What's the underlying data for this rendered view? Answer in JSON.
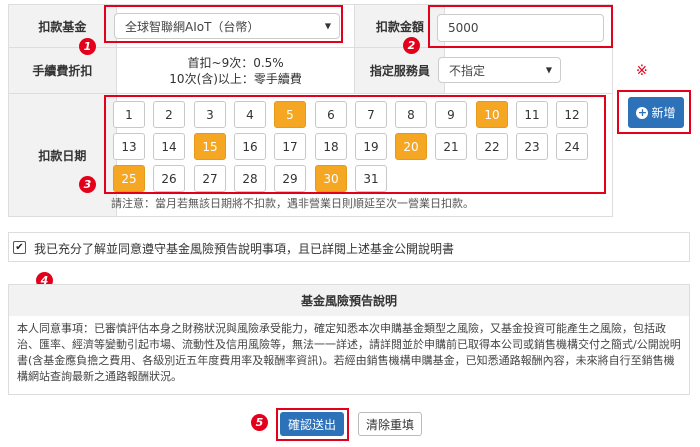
{
  "form": {
    "fund_label": "扣款基金",
    "fund_value": "全球智聯網AIoT（台幣）",
    "amount_label": "扣款金額",
    "amount_value": "5000",
    "fee_label": "手續費折扣",
    "fee_line1": "首扣~9次：0.5%",
    "fee_line2": "10次(含)以上：零手續費",
    "staff_label": "指定服務員",
    "staff_value": "不指定",
    "date_label": "扣款日期",
    "date_note": "請注意：當月若無該日期將不扣款，遇非營業日則順延至次一營業日扣款。",
    "add_button": "新增",
    "asterisk": "※"
  },
  "days": [
    {
      "label": "1",
      "selected": false
    },
    {
      "label": "2",
      "selected": false
    },
    {
      "label": "3",
      "selected": false
    },
    {
      "label": "4",
      "selected": false
    },
    {
      "label": "5",
      "selected": true
    },
    {
      "label": "6",
      "selected": false
    },
    {
      "label": "7",
      "selected": false
    },
    {
      "label": "8",
      "selected": false
    },
    {
      "label": "9",
      "selected": false
    },
    {
      "label": "10",
      "selected": true
    },
    {
      "label": "11",
      "selected": false
    },
    {
      "label": "12",
      "selected": false
    },
    {
      "label": "13",
      "selected": false
    },
    {
      "label": "14",
      "selected": false
    },
    {
      "label": "15",
      "selected": true
    },
    {
      "label": "16",
      "selected": false
    },
    {
      "label": "17",
      "selected": false
    },
    {
      "label": "18",
      "selected": false
    },
    {
      "label": "19",
      "selected": false
    },
    {
      "label": "20",
      "selected": true
    },
    {
      "label": "21",
      "selected": false
    },
    {
      "label": "22",
      "selected": false
    },
    {
      "label": "23",
      "selected": false
    },
    {
      "label": "24",
      "selected": false
    },
    {
      "label": "25",
      "selected": true
    },
    {
      "label": "26",
      "selected": false
    },
    {
      "label": "27",
      "selected": false
    },
    {
      "label": "28",
      "selected": false
    },
    {
      "label": "29",
      "selected": false
    },
    {
      "label": "30",
      "selected": true
    },
    {
      "label": "31",
      "selected": false
    }
  ],
  "agreement": {
    "checked": true,
    "check_mark": "✔",
    "text": "我已充分了解並同意遵守基金風險預告說明事項，且已詳閱上述基金公開說明書"
  },
  "risk": {
    "title": "基金風險預告說明",
    "body": "本人同意事項：已審慎評估本身之財務狀況與風險承受能力，確定知悉本次申購基金類型之風險，又基金投資可能產生之風險，包括政治、匯率、經濟等變動引起市場、流動性及信用風險等，無法一一詳述，請詳閱並於申購前已取得本公司或銷售機構交付之簡式/公開說明書(含基金應負擔之費用、各級別近五年度費用率及報酬率資訊)。若經由銷售機構申購基金，已知悉通路報酬內容，未來將自行至銷售機構網站查詢最新之通路報酬狀況。"
  },
  "actions": {
    "submit": "確認送出",
    "reset": "清除重填"
  },
  "markers": [
    "1",
    "2",
    "3",
    "4",
    "5"
  ],
  "colors": {
    "accent_blue": "#2d72b9",
    "selected_day": "#f5a623",
    "highlight_red": "#e3001b",
    "label_bg": "#f2f2f2"
  }
}
